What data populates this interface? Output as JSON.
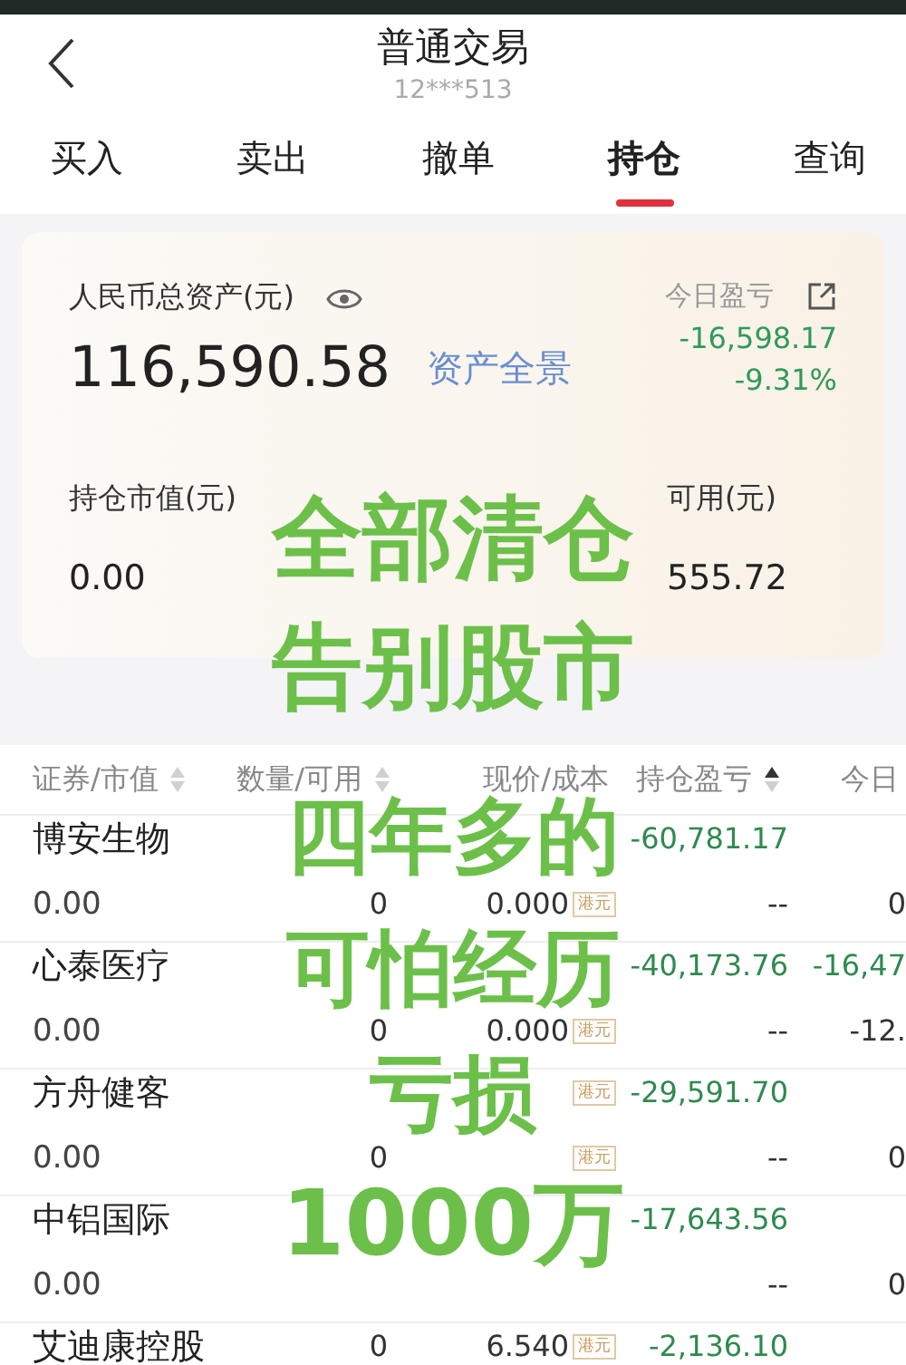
{
  "header": {
    "title": "普通交易",
    "account": "12***513"
  },
  "tabs": [
    {
      "label": "买入",
      "selected": false
    },
    {
      "label": "卖出",
      "selected": false
    },
    {
      "label": "撤单",
      "selected": false
    },
    {
      "label": "持仓",
      "selected": true
    },
    {
      "label": "查询",
      "selected": false
    }
  ],
  "summary": {
    "total_label": "人民币总资产(元)",
    "total": "116,590.58",
    "overview_link": "资产全景",
    "today_label": "今日盈亏",
    "today_pnl": "-16,598.17",
    "today_pct": "-9.31%",
    "stats": [
      {
        "label": "持仓市值(元)",
        "value": "0.00"
      },
      {
        "label": "可用(元)",
        "value": "555.72"
      }
    ]
  },
  "table": {
    "columns": [
      {
        "label": "证券/市值",
        "sortable": true,
        "sorted": false
      },
      {
        "label": "数量/可用",
        "sortable": true,
        "sorted": false
      },
      {
        "label": "现价/成本",
        "sortable": false
      },
      {
        "label": "持仓盈亏",
        "sortable": true,
        "sorted": true
      },
      {
        "label": "今日",
        "sortable": false
      }
    ],
    "rows": [
      {
        "name": "博安生物",
        "value": "0.00",
        "qty": null,
        "avail": "0",
        "price": null,
        "price_tag": null,
        "cost": "0.000",
        "cost_tag": "港元",
        "pnl": "-60,781.17",
        "pnl2": "--",
        "today": null,
        "today2": "0"
      },
      {
        "name": "心泰医疗",
        "value": "0.00",
        "qty": null,
        "avail": "0",
        "price": null,
        "price_tag": null,
        "cost": "0.000",
        "cost_tag": "港元",
        "pnl": "-40,173.76",
        "pnl2": "--",
        "today": "-16,47",
        "today2": "-12."
      },
      {
        "name": "方舟健客",
        "value": "0.00",
        "qty": null,
        "avail": "0",
        "price": null,
        "price_tag": "港元",
        "cost": null,
        "cost_tag": "港元",
        "pnl": "-29,591.70",
        "pnl2": "--",
        "today": null,
        "today2": "0"
      },
      {
        "name": "中铝国际",
        "value": "0.00",
        "qty": null,
        "avail": null,
        "price": null,
        "price_tag": null,
        "cost": null,
        "cost_tag": null,
        "pnl": "-17,643.56",
        "pnl2": "--",
        "today": null,
        "today2": "0"
      },
      {
        "name": "艾迪康控股",
        "value": null,
        "qty": "0",
        "avail": null,
        "price": "6.540",
        "price_tag": "港元",
        "cost": null,
        "cost_tag": null,
        "pnl": "-2,136.10",
        "pnl2": null,
        "today": null,
        "today2": null
      }
    ]
  },
  "overlay": [
    "全部清仓",
    "告别股市",
    "四年多的",
    "可怕经历",
    "亏损",
    "1000万"
  ]
}
